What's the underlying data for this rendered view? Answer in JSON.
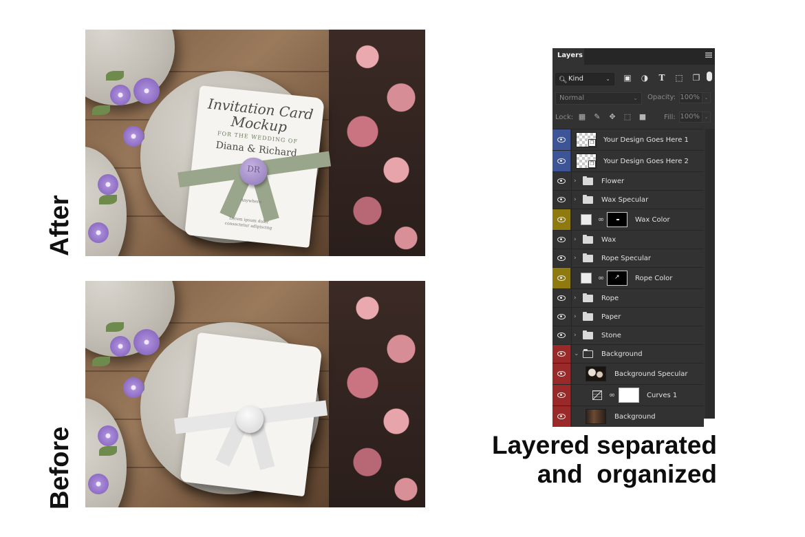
{
  "labels": {
    "after": "After",
    "before": "Before"
  },
  "card": {
    "title_line1": "Invitation Card",
    "title_line2": "Mockup",
    "subtitle": "FOR THE WEDDING OF",
    "names": "Diana & Richard",
    "small_text": "Anywhere",
    "footer_line1": "Lorem ipsum dolor",
    "footer_line2": "consectetur adipiscing",
    "seal_mark": "DR"
  },
  "layers_panel": {
    "tab_label": "Layers",
    "filter_kind": "Kind",
    "blend_mode": "Normal",
    "opacity_label": "Opacity:",
    "opacity_value": "100%",
    "lock_label": "Lock:",
    "fill_label": "Fill:",
    "fill_value": "100%",
    "layers": [
      {
        "name": "Your Design Goes Here 1",
        "type": "smart-object",
        "color": "blue"
      },
      {
        "name": "Your Design Goes Here 2",
        "type": "smart-object",
        "color": "blue"
      },
      {
        "name": "Flower",
        "type": "group",
        "color": "none"
      },
      {
        "name": "Wax Specular",
        "type": "group",
        "color": "none"
      },
      {
        "name": "Wax Color",
        "type": "fill-with-mask",
        "color": "yellow"
      },
      {
        "name": "Wax",
        "type": "group",
        "color": "none"
      },
      {
        "name": "Rope Specular",
        "type": "group",
        "color": "none"
      },
      {
        "name": "Rope Color",
        "type": "fill-with-mask",
        "color": "yellow"
      },
      {
        "name": "Rope",
        "type": "group",
        "color": "none"
      },
      {
        "name": "Paper",
        "type": "group",
        "color": "none"
      },
      {
        "name": "Stone",
        "type": "group",
        "color": "none"
      },
      {
        "name": "Background",
        "type": "group-open",
        "color": "red"
      },
      {
        "name": "Background Specular",
        "type": "image",
        "color": "red"
      },
      {
        "name": "Curves 1",
        "type": "adjustment",
        "color": "red"
      },
      {
        "name": "Background",
        "type": "image",
        "color": "red"
      }
    ]
  },
  "tagline": {
    "line1": "Layered separated",
    "line2": "and  organized"
  },
  "colors": {
    "panel_bg": "#323232",
    "label_blue": "#3d5496",
    "label_yellow": "#8f7a10",
    "label_red": "#9a2a2a"
  }
}
